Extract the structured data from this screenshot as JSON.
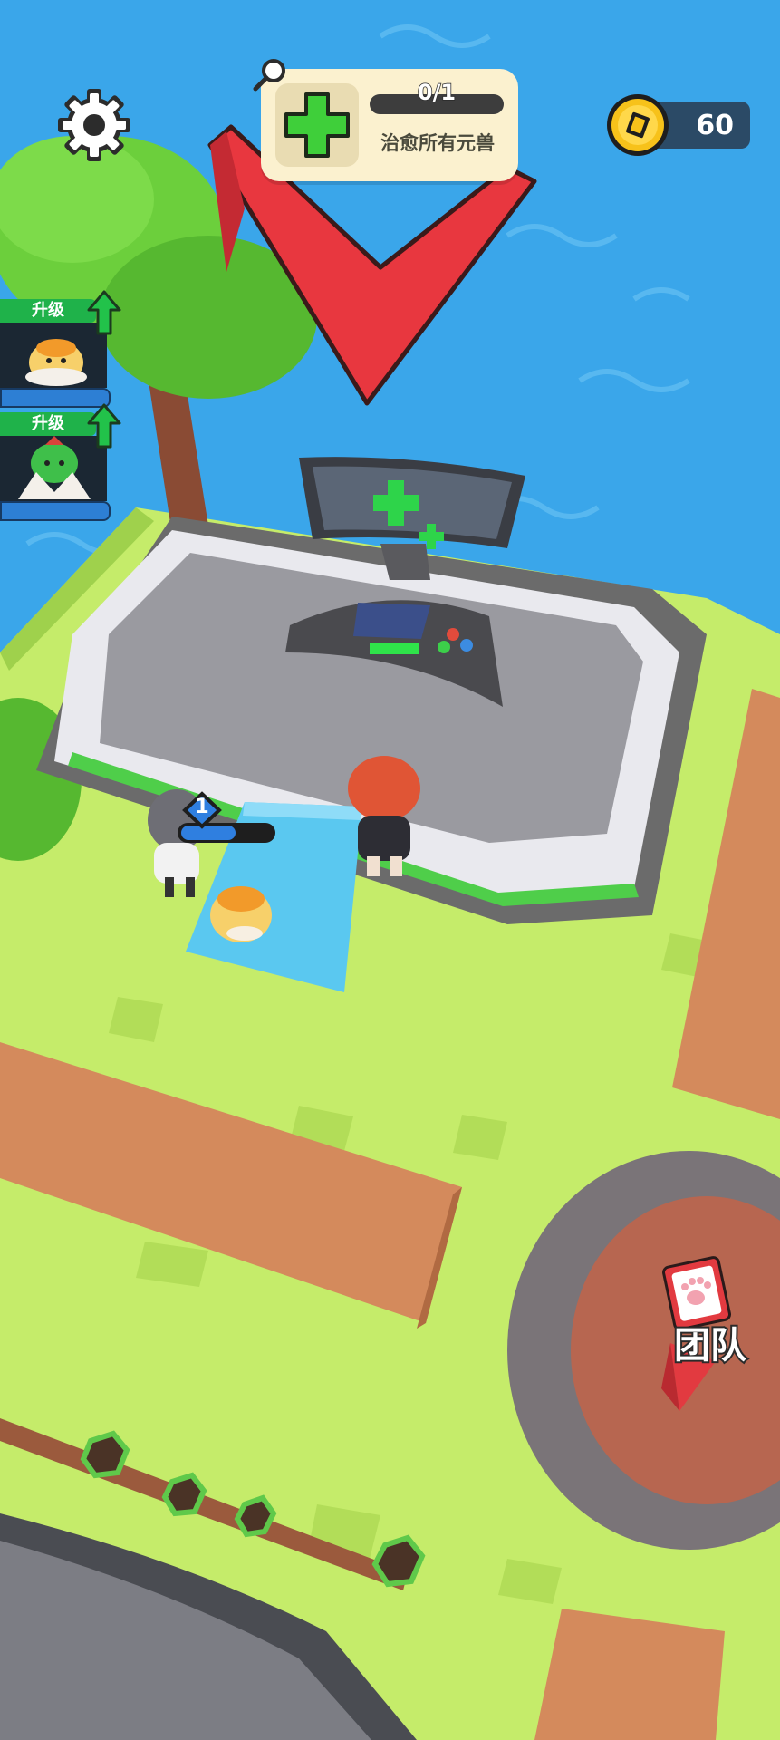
{
  "hud": {
    "settings_icon": "gear-icon",
    "coins": {
      "value": "60",
      "icon": "gold-coin-icon"
    },
    "quest": {
      "progress_text": "0/1",
      "progress": 0,
      "description": "治愈所有元兽",
      "icon": "green-cross-icon"
    }
  },
  "upgrades": [
    {
      "label": "升级",
      "monster": "yellow-chick-monster",
      "icon": "green-up-arrow-icon"
    },
    {
      "label": "升级",
      "monster": "green-plant-monster",
      "icon": "green-up-arrow-icon"
    }
  ],
  "player": {
    "level": "1"
  },
  "team_button": {
    "label": "团队",
    "icon": "paw-card-icon"
  },
  "colors": {
    "water": "#3aa6ea",
    "grass": "#c5ec6a",
    "dirt": "#d48a5c",
    "marker": "#e8373f",
    "accent_green": "#1fb24a",
    "panel": "#fbf1cf"
  }
}
